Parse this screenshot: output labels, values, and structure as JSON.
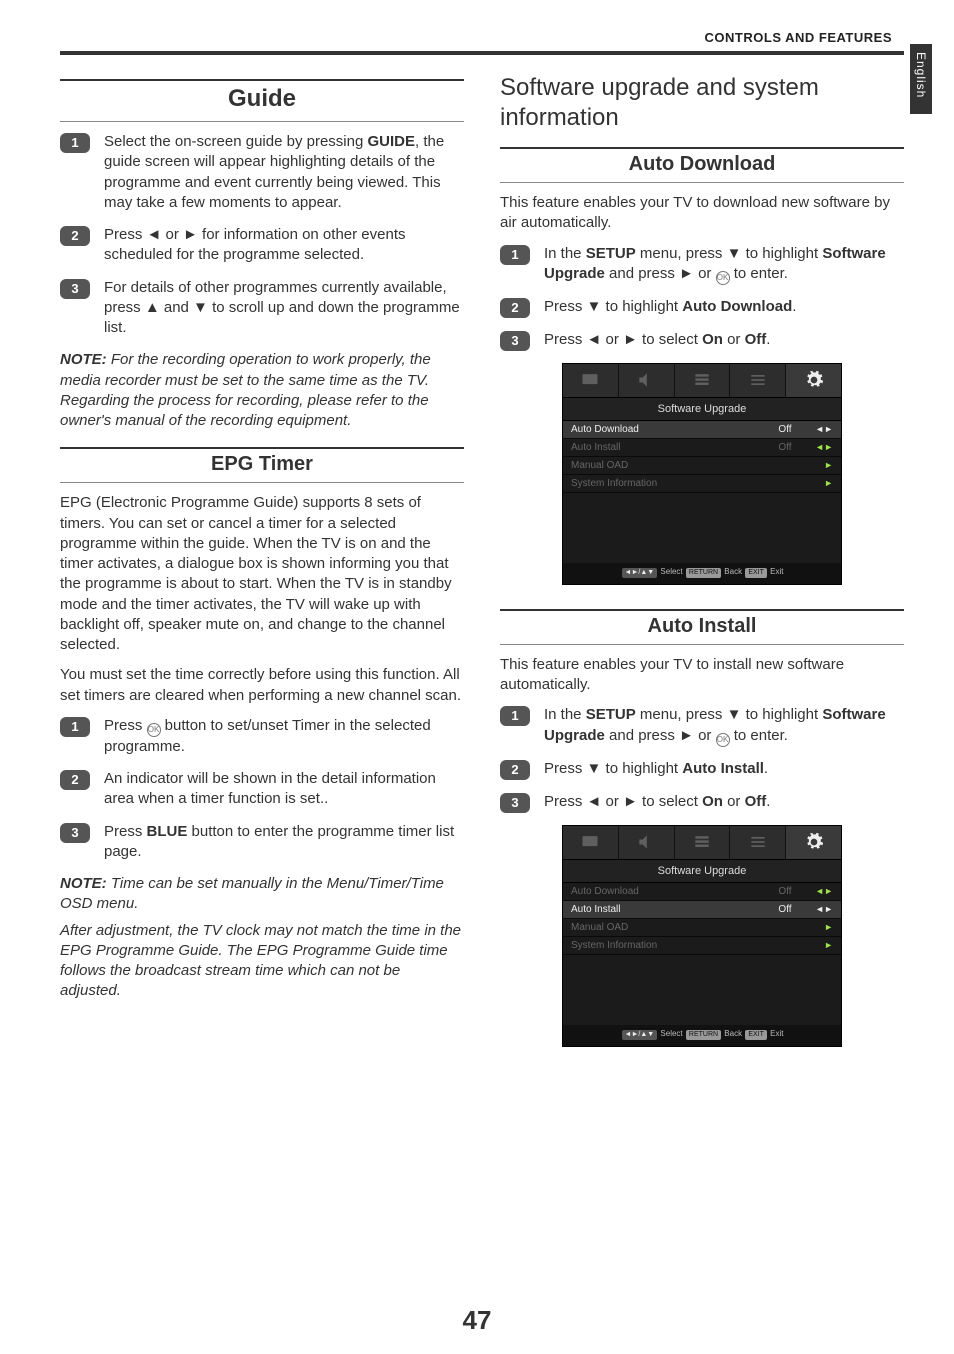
{
  "header": {
    "breadcrumb": "CONTROLS AND FEATURES"
  },
  "side_tab": "English",
  "page_number": "47",
  "left": {
    "guide": {
      "title": "Guide",
      "steps": [
        {
          "num": "1",
          "html": "Select the on-screen guide by pressing <b>GUIDE</b>, the guide screen will appear highlighting details of the programme and event currently being viewed. This may take a few moments to appear."
        },
        {
          "num": "2",
          "html": "Press ◄ or ► for information on other events scheduled for the programme selected."
        },
        {
          "num": "3",
          "html": "For details of other programmes currently available, press ▲ and ▼ to scroll up and down the programme list."
        }
      ],
      "note": "<b><i>NOTE:</i></b> For the recording operation to work properly, the media recorder must be set to the same time as the TV. Regarding the process for recording, please refer to the owner's manual of the recording equipment."
    },
    "epg": {
      "title": "EPG Timer",
      "intro1": "EPG (Electronic Programme Guide) supports 8 sets of timers. You can set or cancel a timer for a selected programme within the guide. When the TV is on and the timer activates, a dialogue box is shown informing you that the programme is about to start. When the TV is in standby mode and the timer activates, the TV will wake up with backlight off, speaker mute on, and change to the channel selected.",
      "intro2": "You must set the time correctly before using this function. All set timers are cleared when performing a new channel scan.",
      "steps": [
        {
          "num": "1",
          "html": "Press <span class='ok-icon'>OK</span> button to set/unset Timer in the selected programme."
        },
        {
          "num": "2",
          "html": "An indicator will be shown in the detail information area when a timer function is set.."
        },
        {
          "num": "3",
          "html": "Press <b>BLUE</b> button to enter the programme timer list page."
        }
      ],
      "note1": "<b><i>NOTE:</i></b>  Time can be set manually in the Menu/Timer/Time OSD menu.",
      "note2": "After adjustment, the TV clock may not match the time in the EPG Programme Guide.  The EPG Programme Guide time follows the broadcast stream time which can not be adjusted."
    }
  },
  "right": {
    "section_title": "Software upgrade and system information",
    "auto_download": {
      "title": "Auto Download",
      "intro": "This feature enables your TV to download new software by air automatically.",
      "steps": [
        {
          "num": "1",
          "html": "In the <b>SETUP</b> menu, press ▼ to highlight <b>Software Upgrade</b> and press ► or <span class='ok-icon'>OK</span> to enter."
        },
        {
          "num": "2",
          "html": "Press ▼ to highlight <b>Auto Download</b>."
        },
        {
          "num": "3",
          "html": "Press ◄ or ► to select <b>On</b> or <b>Off</b>."
        }
      ],
      "osd": {
        "title": "Software Upgrade",
        "rows": [
          {
            "label": "Auto Download",
            "value": "Off",
            "hl": true,
            "arrow": "◄►"
          },
          {
            "label": "Auto Install",
            "value": "Off",
            "hl": false,
            "arrow": "◄►"
          },
          {
            "label": "Manual OAD",
            "value": "",
            "hl": false,
            "arrow": "►"
          },
          {
            "label": "System Information",
            "value": "",
            "hl": false,
            "arrow": "►"
          }
        ],
        "footer": {
          "nav": "◄►/▲▼",
          "select": "Select",
          "return_chip": "RETURN",
          "back": "Back",
          "exit_chip": "EXIT",
          "exit": "Exit"
        }
      }
    },
    "auto_install": {
      "title": "Auto Install",
      "intro": "This feature enables your TV to install new software automatically.",
      "steps": [
        {
          "num": "1",
          "html": "In the <b>SETUP</b> menu, press ▼ to highlight <b>Software Upgrade</b> and press ► or <span class='ok-icon'>OK</span> to enter."
        },
        {
          "num": "2",
          "html": "Press ▼ to highlight <b>Auto Install</b>."
        },
        {
          "num": "3",
          "html": "Press ◄ or ► to select <b>On</b> or <b>Off</b>."
        }
      ],
      "osd": {
        "title": "Software Upgrade",
        "rows": [
          {
            "label": "Auto Download",
            "value": "Off",
            "hl": false,
            "arrow": "◄►"
          },
          {
            "label": "Auto Install",
            "value": "Off",
            "hl": true,
            "arrow": "◄►"
          },
          {
            "label": "Manual OAD",
            "value": "",
            "hl": false,
            "arrow": "►"
          },
          {
            "label": "System Information",
            "value": "",
            "hl": false,
            "arrow": "►"
          }
        ],
        "footer": {
          "nav": "◄►/▲▼",
          "select": "Select",
          "return_chip": "RETURN",
          "back": "Back",
          "exit_chip": "EXIT",
          "exit": "Exit"
        }
      }
    }
  }
}
